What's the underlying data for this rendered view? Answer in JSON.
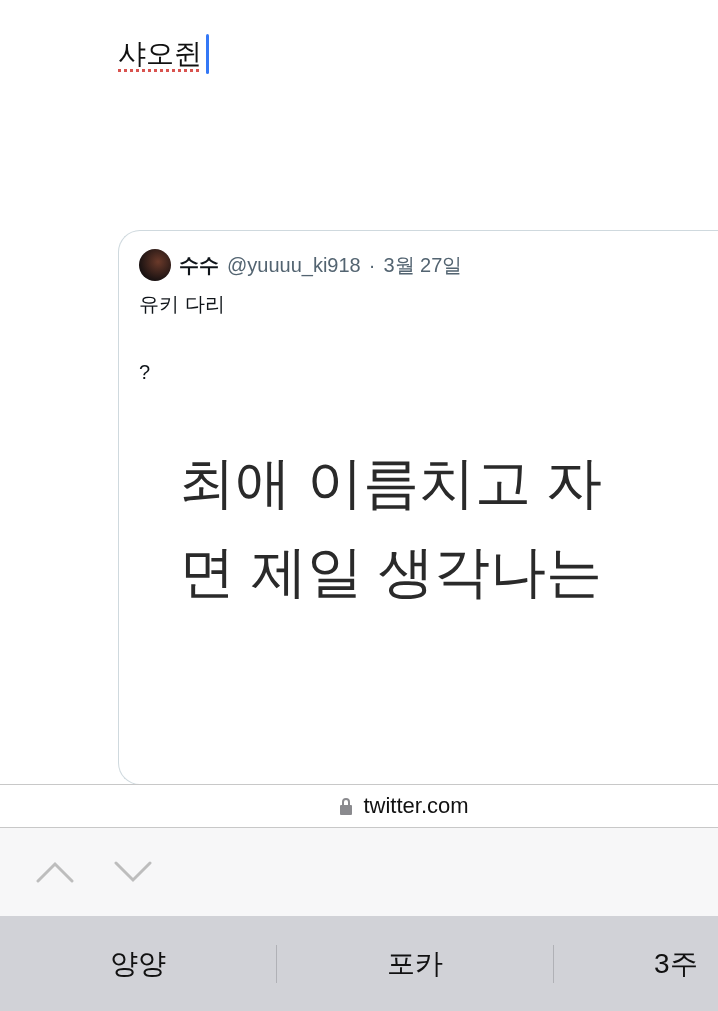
{
  "compose": {
    "value": "샤오쥔",
    "misspelled": true
  },
  "quoted_tweet": {
    "name": "수수",
    "handle": "@yuuuu_ki918",
    "separator": "·",
    "date": "3월 27일",
    "text_lines": [
      "유키 다리",
      "?"
    ],
    "image_lines": [
      "최애 이름치고 자",
      "면 제일 생각나는"
    ]
  },
  "address_bar": {
    "domain": "twitter.com"
  },
  "suggestions": [
    {
      "label": "양양"
    },
    {
      "label": "포카"
    },
    {
      "label": "3주"
    }
  ]
}
